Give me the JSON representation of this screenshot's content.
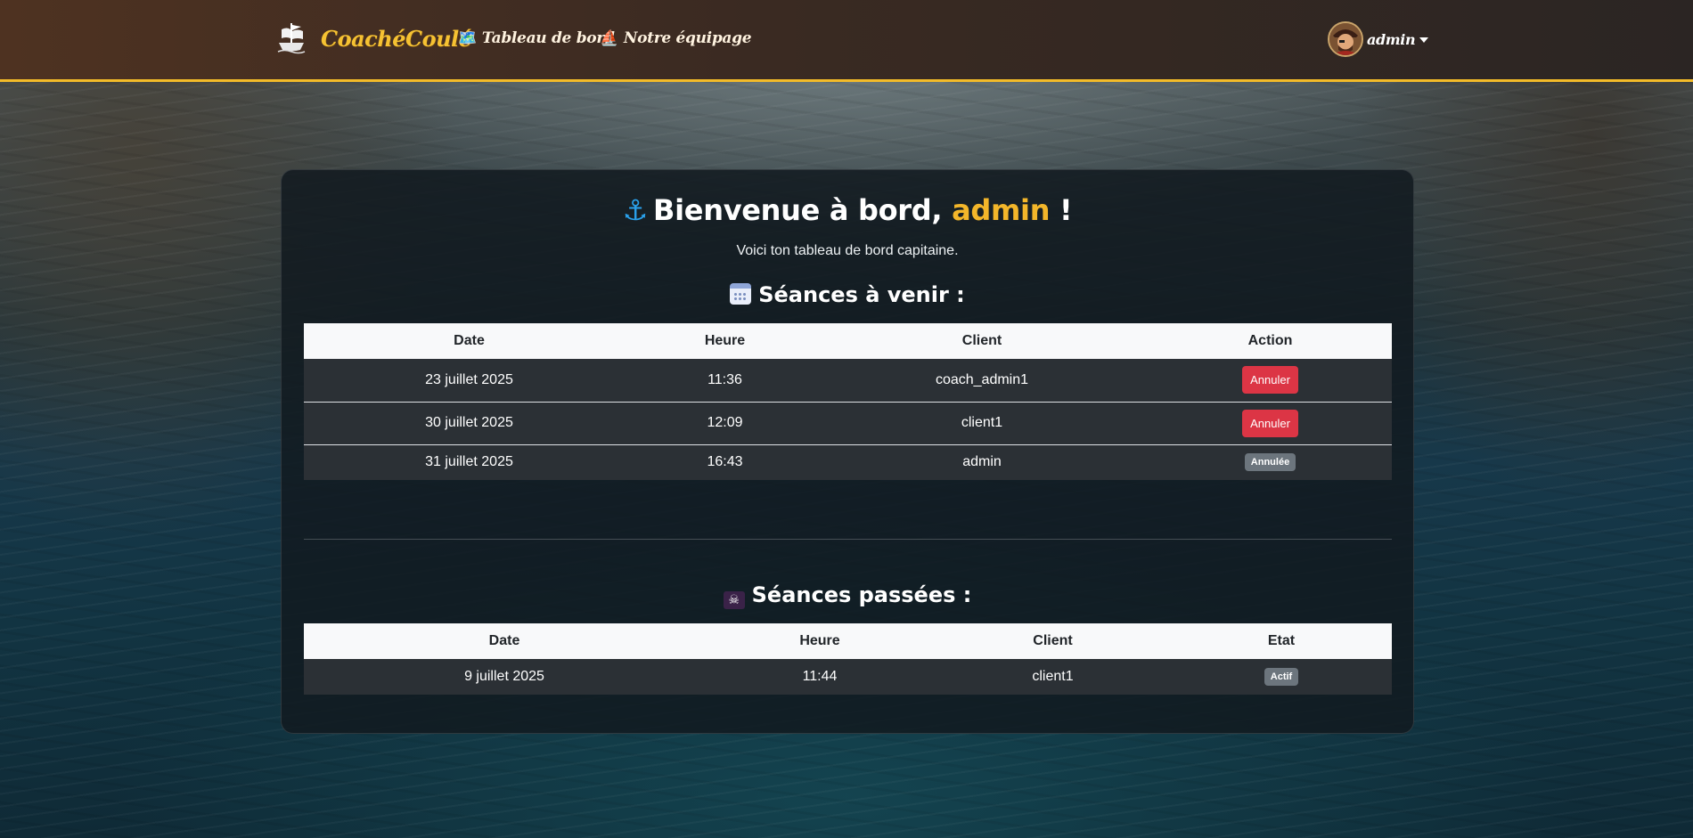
{
  "navbar": {
    "brand": "CoachéCoulé",
    "links": [
      {
        "icon": "🗺️",
        "label": "Tableau de bord"
      },
      {
        "icon": "⛵",
        "label": "Notre équipage"
      }
    ],
    "user": {
      "name": "admin"
    }
  },
  "main": {
    "welcome_prefix": "Bienvenue à bord, ",
    "welcome_user": "admin",
    "welcome_suffix": " !",
    "subtitle": "Voici ton tableau de bord capitaine.",
    "upcoming": {
      "title": "Séances à venir :",
      "headers": [
        "Date",
        "Heure",
        "Client",
        "Action"
      ],
      "rows": [
        {
          "date": "23 juillet 2025",
          "time": "11:36",
          "client": "coach_admin1",
          "action": "Annuler"
        },
        {
          "date": "30 juillet 2025",
          "time": "12:09",
          "client": "client1",
          "action": "Annuler"
        },
        {
          "date": "31 juillet 2025",
          "time": "16:43",
          "client": "admin",
          "status": "Annulée"
        }
      ]
    },
    "past": {
      "title": "Séances passées :",
      "headers": [
        "Date",
        "Heure",
        "Client",
        "Etat"
      ],
      "rows": [
        {
          "date": "9 juillet 2025",
          "time": "11:44",
          "client": "client1",
          "status": "Actif"
        }
      ]
    }
  },
  "colors": {
    "accent": "#f3bb29",
    "danger": "#dc3545",
    "badge": "#6c757d"
  },
  "icons": {
    "brand": "pirate-ship-icon",
    "welcome": "anchor-icon",
    "upcoming": "calendar-icon",
    "past": "skull-flag-icon"
  }
}
